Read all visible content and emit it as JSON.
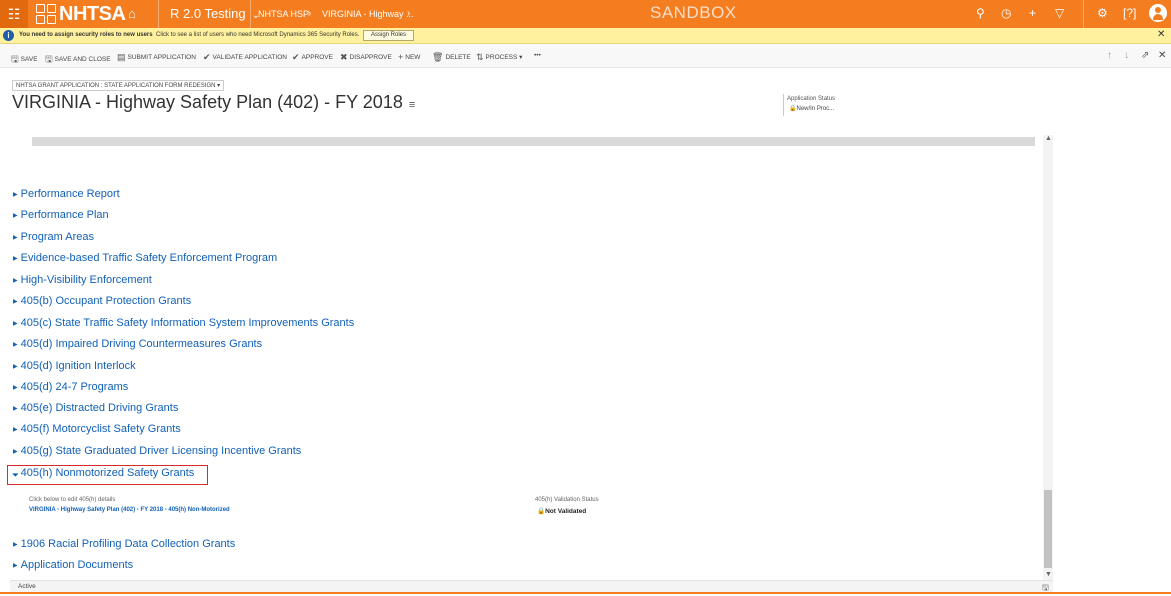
{
  "topbar": {
    "logo_text": "NHTSA",
    "app_name": "R 2.0 Testing",
    "breadcrumb": [
      "NHTSA HSP",
      "VIRGINIA - Highway ..."
    ],
    "environment": "SANDBOX",
    "colors": {
      "brand": "#f47d20",
      "link": "#1160b7",
      "highlight_border": "#d62b2b",
      "notification": "#fff19d"
    },
    "icons": [
      "search-icon",
      "history-icon",
      "plus-icon",
      "filter-icon",
      "settings-icon",
      "help-icon",
      "user-avatar-icon"
    ]
  },
  "notification": {
    "bold_message": "You need to assign security roles to new users",
    "message": "Click to see a list of users who need Microsoft Dynamics 365 Security Roles.",
    "button": "Assign Roles"
  },
  "commands": {
    "save": "SAVE",
    "save_close": "SAVE AND CLOSE",
    "submit": "SUBMIT APPLICATION",
    "validate": "VALIDATE APPLICATION",
    "approve": "APPROVE",
    "disapprove": "DISAPPROVE",
    "new": "NEW",
    "delete": "DELETE",
    "process": "PROCESS",
    "more": "•••"
  },
  "header": {
    "form_selector": "NHTSA GRANT APPLICATION : STATE APPLICATION FORM REDESIGN",
    "title": "VIRGINIA - Highway Safety Plan (402) - FY 2018",
    "status_label": "Application Status",
    "status_value": "New/In Proc..."
  },
  "sections": [
    "Performance Report",
    "Performance Plan",
    "Program Areas",
    "Evidence-based Traffic Safety Enforcement Program",
    "High-Visibility Enforcement",
    "405(b) Occupant Protection Grants",
    "405(c) State Traffic Safety Information System Improvements Grants",
    "405(d) Impaired Driving Countermeasures Grants",
    "405(d) Ignition Interlock",
    "405(d) 24-7 Programs",
    "405(e) Distracted Driving Grants",
    "405(f) Motorcyclist Safety Grants",
    "405(g) State Graduated Driver Licensing Incentive Grants",
    "405(h) Nonmotorized Safety Grants",
    "1906 Racial Profiling Data Collection Grants",
    "Application Documents"
  ],
  "expanded_section": {
    "edit_label": "Click below to edit 405(h) details",
    "edit_link": "VIRGINIA - Highway Safety Plan (402) - FY 2018 - 405(h) Non-Motorized",
    "validation_label": "405(h) Validation Status",
    "validation_value": "Not Validated"
  },
  "footer": {
    "state": "Active"
  }
}
